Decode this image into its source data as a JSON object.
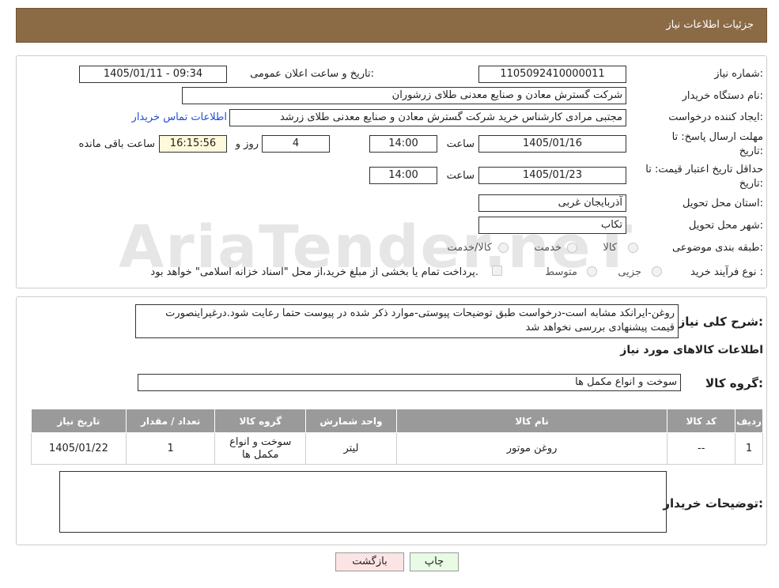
{
  "header": {
    "title": "جزئیات اطلاعات نیاز"
  },
  "watermark": {
    "text": "AriaTender.neT"
  },
  "form": {
    "need_number_label": "شماره نیاز:",
    "need_number": "1105092410000011",
    "announce_label": "تاریخ و ساعت اعلان عمومی:",
    "announce_value": "1405/01/11 - 09:34",
    "buyer_org_label": "نام دستگاه خریدار:",
    "buyer_org": "شرکت گسترش معادن و صنایع معدنی طلای زرشوران",
    "creator_label": "ایجاد کننده درخواست:",
    "creator": "مجتبی مرادی کارشناس خرید شرکت گسترش معادن و صنایع معدنی طلای زرشد",
    "contact_link": "اطلاعات تماس خریدار",
    "deadline_label_1": "مهلت ارسال پاسخ: تا",
    "deadline_label_2": "تاریخ:",
    "deadline_date": "1405/01/16",
    "time_label": "ساعت",
    "deadline_time": "14:00",
    "days_value": "4",
    "days_label": "روز و",
    "remaining_time": "16:15:56",
    "remaining_label": "ساعت باقی مانده",
    "validity_label_1": "حداقل تاریخ اعتبار قیمت: تا",
    "validity_label_2": "تاریخ:",
    "validity_date": "1405/01/23",
    "validity_time": "14:00",
    "province_label": "استان محل تحویل:",
    "province": "آذربایجان غربی",
    "city_label": "شهر محل تحویل:",
    "city": "تکاب",
    "category_label": "طبقه بندی موضوعی:",
    "category_options": [
      "کالا",
      "خدمت",
      "کالا/خدمت"
    ],
    "process_label": "نوع فرآیند خرید :",
    "process_options": [
      "جزیی",
      "متوسط"
    ],
    "payment_note": "پرداخت تمام یا بخشی از مبلغ خرید،از محل \"اسناد خزانه اسلامی\" خواهد بود."
  },
  "description": {
    "label": "شرح کلی نیاز:",
    "text": "روغن-ایرانکد مشابه است-درخواست طبق توضیحات پیوستی-موارد ذکر شده در پیوست حتما رعایت شود.درغیراینصورت قیمت پیشنهادی بررسی نخواهد شد"
  },
  "goods": {
    "section_title": "اطلاعات کالاهای مورد نیاز",
    "group_label": "گروه کالا:",
    "group_value": "سوخت و انواع مکمل ها",
    "columns": [
      "ردیف",
      "کد کالا",
      "نام کالا",
      "واحد شمارش",
      "گروه کالا",
      "تعداد / مقدار",
      "تاریخ نیاز"
    ],
    "rows": [
      [
        "1",
        "--",
        "روغن موتور",
        "لیتر",
        "سوخت و انواع مکمل ها",
        "1",
        "1405/01/22"
      ]
    ]
  },
  "buyer_notes": {
    "label": "توضیحات خریدار:",
    "text": ""
  },
  "buttons": {
    "print": "چاپ",
    "back": "بازگشت"
  },
  "colors": {
    "header_bg": "#8b6b46",
    "table_header_bg": "#9a9a9a",
    "print_btn": "#e9fbe4",
    "back_btn": "#fde4e4",
    "link": "#1f4ed8"
  }
}
